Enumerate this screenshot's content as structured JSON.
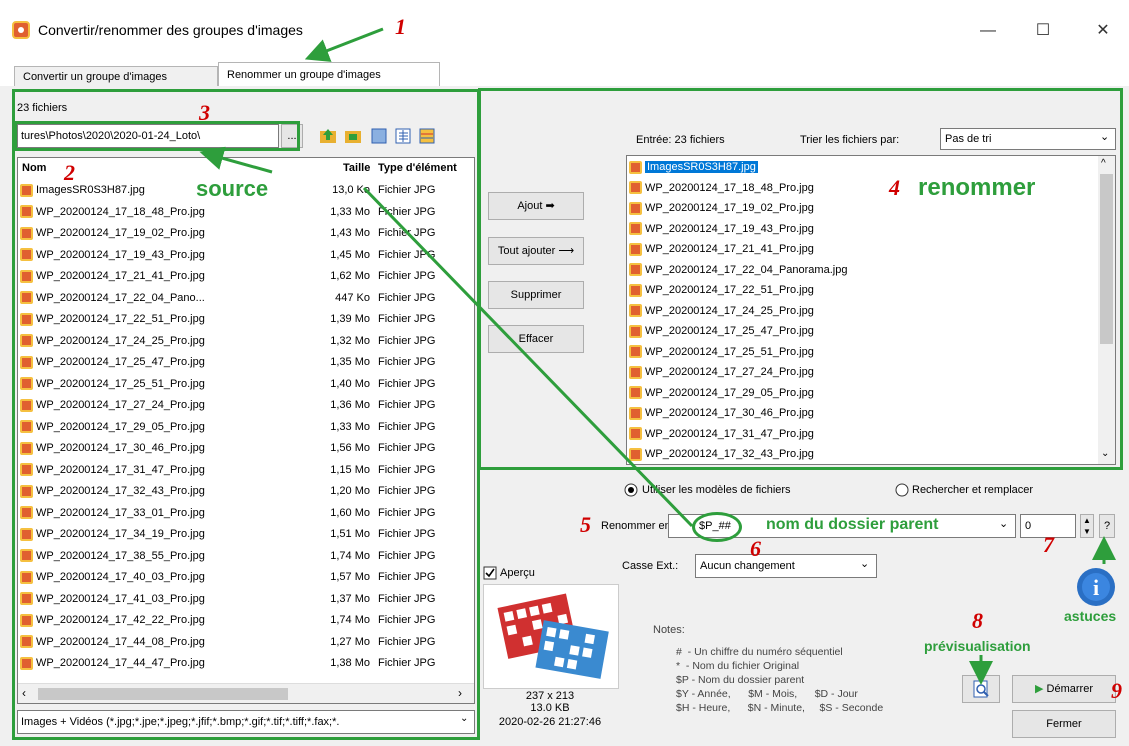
{
  "window": {
    "title": "Convertir/renommer des groupes d'images",
    "minimize": "—",
    "maximize": "☐",
    "close": "✕"
  },
  "tabs": [
    "Convertir un groupe d'images",
    "Renommer un groupe d'images"
  ],
  "left": {
    "count": "23 fichiers",
    "path": "tures\\Photos\\2020\\2020-01-24_Loto\\",
    "browse": "...",
    "columns": [
      "Nom",
      "Taille",
      "Type d'élément"
    ],
    "files": [
      [
        "ImagesSR0S3H87.jpg",
        "13,0 Ko",
        "Fichier JPG"
      ],
      [
        "WP_20200124_17_18_48_Pro.jpg",
        "1,33 Mo",
        "Fichier JPG"
      ],
      [
        "WP_20200124_17_19_02_Pro.jpg",
        "1,43 Mo",
        "Fichier JPG"
      ],
      [
        "WP_20200124_17_19_43_Pro.jpg",
        "1,45 Mo",
        "Fichier JPG"
      ],
      [
        "WP_20200124_17_21_41_Pro.jpg",
        "1,62 Mo",
        "Fichier JPG"
      ],
      [
        "WP_20200124_17_22_04_Pano...",
        "447 Ko",
        "Fichier JPG"
      ],
      [
        "WP_20200124_17_22_51_Pro.jpg",
        "1,39 Mo",
        "Fichier JPG"
      ],
      [
        "WP_20200124_17_24_25_Pro.jpg",
        "1,32 Mo",
        "Fichier JPG"
      ],
      [
        "WP_20200124_17_25_47_Pro.jpg",
        "1,35 Mo",
        "Fichier JPG"
      ],
      [
        "WP_20200124_17_25_51_Pro.jpg",
        "1,40 Mo",
        "Fichier JPG"
      ],
      [
        "WP_20200124_17_27_24_Pro.jpg",
        "1,36 Mo",
        "Fichier JPG"
      ],
      [
        "WP_20200124_17_29_05_Pro.jpg",
        "1,33 Mo",
        "Fichier JPG"
      ],
      [
        "WP_20200124_17_30_46_Pro.jpg",
        "1,56 Mo",
        "Fichier JPG"
      ],
      [
        "WP_20200124_17_31_47_Pro.jpg",
        "1,15 Mo",
        "Fichier JPG"
      ],
      [
        "WP_20200124_17_32_43_Pro.jpg",
        "1,20 Mo",
        "Fichier JPG"
      ],
      [
        "WP_20200124_17_33_01_Pro.jpg",
        "1,60 Mo",
        "Fichier JPG"
      ],
      [
        "WP_20200124_17_34_19_Pro.jpg",
        "1,51 Mo",
        "Fichier JPG"
      ],
      [
        "WP_20200124_17_38_55_Pro.jpg",
        "1,74 Mo",
        "Fichier JPG"
      ],
      [
        "WP_20200124_17_40_03_Pro.jpg",
        "1,57 Mo",
        "Fichier JPG"
      ],
      [
        "WP_20200124_17_41_03_Pro.jpg",
        "1,37 Mo",
        "Fichier JPG"
      ],
      [
        "WP_20200124_17_42_22_Pro.jpg",
        "1,74 Mo",
        "Fichier JPG"
      ],
      [
        "WP_20200124_17_44_08_Pro.jpg",
        "1,27 Mo",
        "Fichier JPG"
      ],
      [
        "WP_20200124_17_44_47_Pro.jpg",
        "1,38 Mo",
        "Fichier JPG"
      ]
    ],
    "filter": "Images + Vidéos (*.jpg;*.jpe;*.jpeg;*.jfif;*.bmp;*.gif;*.tif;*.tiff;*.fax;*."
  },
  "middle": {
    "add": "Ajout ➡",
    "add_all": "Tout ajouter ⟶",
    "remove": "Supprimer",
    "clear": "Effacer"
  },
  "right": {
    "entry": "Entrée: 23 fichiers",
    "sort_label": "Trier les fichiers par:",
    "sort_value": "Pas de tri",
    "files": [
      "ImagesSR0S3H87.jpg",
      "WP_20200124_17_18_48_Pro.jpg",
      "WP_20200124_17_19_02_Pro.jpg",
      "WP_20200124_17_19_43_Pro.jpg",
      "WP_20200124_17_21_41_Pro.jpg",
      "WP_20200124_17_22_04_Panorama.jpg",
      "WP_20200124_17_22_51_Pro.jpg",
      "WP_20200124_17_24_25_Pro.jpg",
      "WP_20200124_17_25_47_Pro.jpg",
      "WP_20200124_17_25_51_Pro.jpg",
      "WP_20200124_17_27_24_Pro.jpg",
      "WP_20200124_17_29_05_Pro.jpg",
      "WP_20200124_17_30_46_Pro.jpg",
      "WP_20200124_17_31_47_Pro.jpg",
      "WP_20200124_17_32_43_Pro.jpg"
    ]
  },
  "options": {
    "use_models": "Utiliser les modèles de fichiers",
    "search_replace": "Rechercher et remplacer",
    "rename_label": "Renommer en",
    "rename_value": "$P_##",
    "start_value": "0",
    "help": "?",
    "case_label": "Casse Ext.:",
    "case_value": "Aucun changement",
    "preview_label": "Aperçu",
    "thumb_size": "237 x 213",
    "thumb_kb": "13.0 KB",
    "thumb_date": "2020-02-26 21:27:46",
    "notes_title": "Notes:",
    "notes": [
      "#  - Un chiffre du numéro séquentiel",
      "*  - Nom du fichier Original",
      "$P - Nom du dossier parent",
      "$Y - Année,      $M - Mois,      $D - Jour",
      "$H - Heure,      $N - Minute,     $S - Seconde"
    ],
    "start": "Démarrer",
    "close": "Fermer"
  },
  "annotations": {
    "n1": "1",
    "n2": "2",
    "n3": "3",
    "n4": "4",
    "n5": "5",
    "n6": "6",
    "n7": "7",
    "n8": "8",
    "n9": "9",
    "source": "source",
    "renommer": "renommer",
    "parent": "nom du dossier parent",
    "astuces": "astuces",
    "preview": "prévisualisation"
  },
  "colors": {
    "annotation_green": "#2e9e3c",
    "annotation_red": "#d00000",
    "selection": "#0078d7"
  }
}
